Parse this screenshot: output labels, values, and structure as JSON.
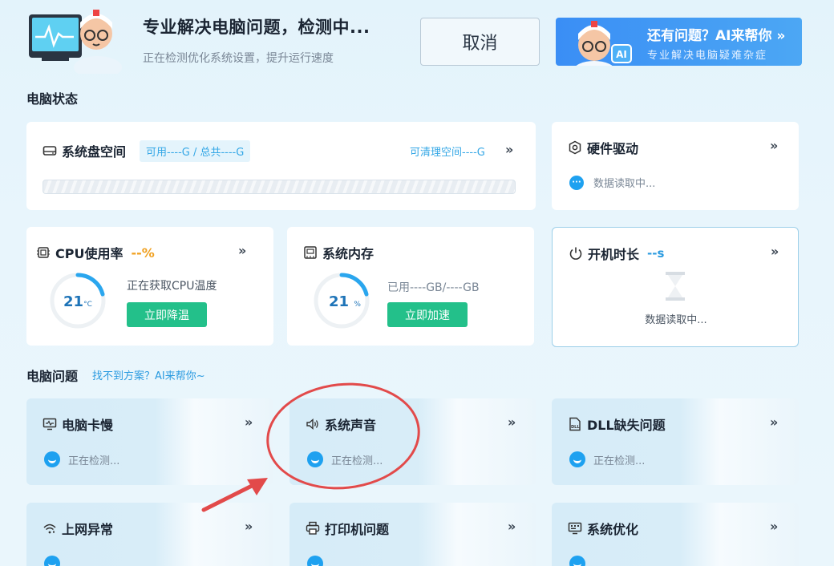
{
  "header": {
    "title": "专业解决电脑问题，检测中...",
    "subtitle": "正在检测优化系统设置，提升运行速度",
    "cancel_label": "取消",
    "ai_banner_title": "还有问题？AI来帮你 »",
    "ai_banner_sub": "专业解决电脑疑难杂症",
    "ai_badge": "AI"
  },
  "status_section": {
    "title": "电脑状态",
    "disk": {
      "title": "系统盘空间",
      "pill": "可用----G / 总共----G",
      "clean": "可清理空间----G"
    },
    "driver": {
      "title": "硬件驱动",
      "status": "数据读取中..."
    },
    "cpu": {
      "title": "CPU使用率",
      "value": "--%",
      "temp_value": "21",
      "temp_unit": "°C",
      "desc": "正在获取CPU温度",
      "button": "立即降温"
    },
    "memory": {
      "title": "系统内存",
      "value": "21",
      "unit": "%",
      "desc": "已用----GB/----GB",
      "button": "立即加速"
    },
    "uptime": {
      "title": "开机时长",
      "value": "--s",
      "status": "数据读取中..."
    },
    "chevron": "»"
  },
  "problems_section": {
    "title": "电脑问题",
    "link": "找不到方案？AI来帮你~",
    "items": [
      {
        "label": "电脑卡慢",
        "status": "正在检测..."
      },
      {
        "label": "系统声音",
        "status": "正在检测..."
      },
      {
        "label": "DLL缺失问题",
        "status": "正在检测..."
      },
      {
        "label": "上网异常"
      },
      {
        "label": "打印机问题"
      },
      {
        "label": "系统优化"
      }
    ]
  },
  "colors": {
    "accent": "#1ea1f0",
    "green": "#23c08a",
    "orange": "#f0a020",
    "annotation": "#e24a4a"
  },
  "gauges": {
    "cpu_temp_fraction": 0.21,
    "memory_fraction": 0.21
  }
}
